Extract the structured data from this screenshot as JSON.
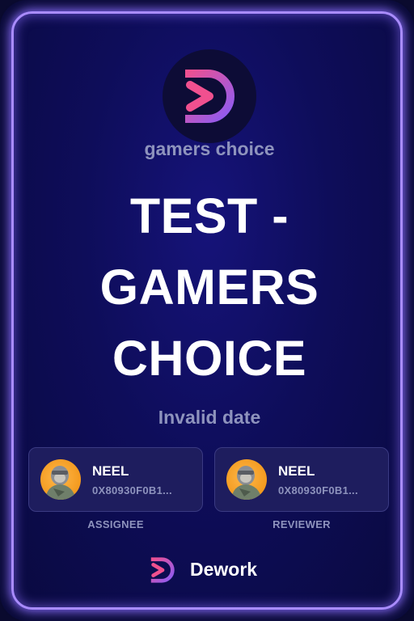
{
  "org": {
    "name": "gamers choice",
    "logo": "dework-d-logo"
  },
  "task": {
    "title": "TEST - GAMERS CHOICE",
    "date": "Invalid date"
  },
  "assignee": {
    "name": "NEEL",
    "address": "0X80930F0B1...",
    "role_label": "ASSIGNEE",
    "avatar": "ape-avatar"
  },
  "reviewer": {
    "name": "NEEL",
    "address": "0X80930F0B1...",
    "role_label": "REVIEWER",
    "avatar": "ape-avatar"
  },
  "brand": {
    "name": "Dework",
    "logo": "dework-d-logo"
  },
  "colors": {
    "border_glow": "#a98cff",
    "card_bg": "#0e0d5a",
    "muted_text": "#8e93bd",
    "logo_pink": "#e8488a",
    "logo_purple": "#8a5cf6"
  }
}
